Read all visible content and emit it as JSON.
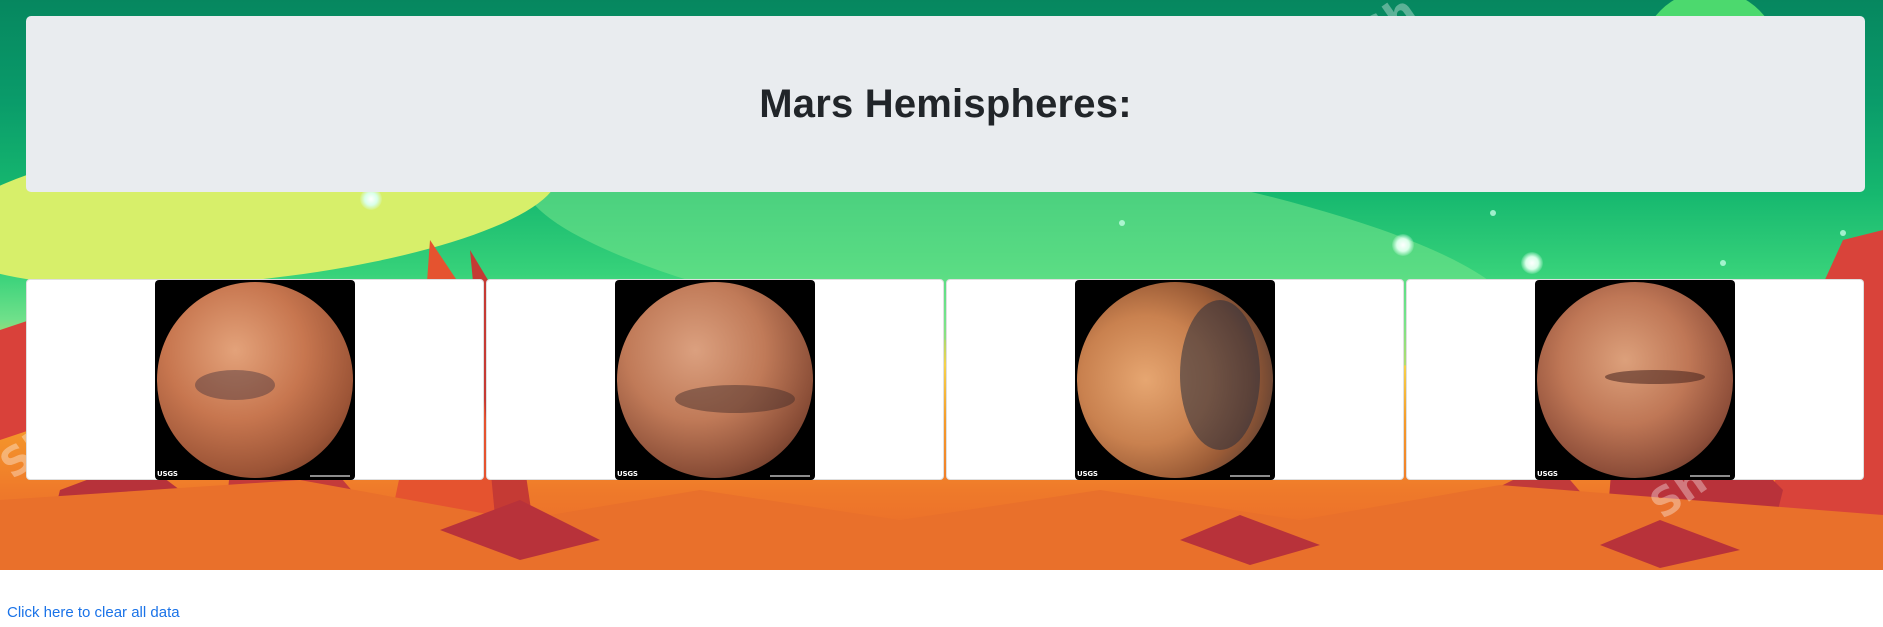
{
  "header": {
    "title": "Mars Hemispheres:"
  },
  "hemispheres": [
    {
      "name": "hemisphere-1",
      "credit": "USGS"
    },
    {
      "name": "hemisphere-2",
      "credit": "USGS"
    },
    {
      "name": "hemisphere-3",
      "credit": "USGS"
    },
    {
      "name": "hemisphere-4",
      "credit": "USGS"
    }
  ],
  "footer": {
    "clear_link": "Click here to clear all data"
  },
  "colors": {
    "jumbotron_bg": "#e9ecef",
    "link": "#1a73e8",
    "title": "#212529"
  }
}
